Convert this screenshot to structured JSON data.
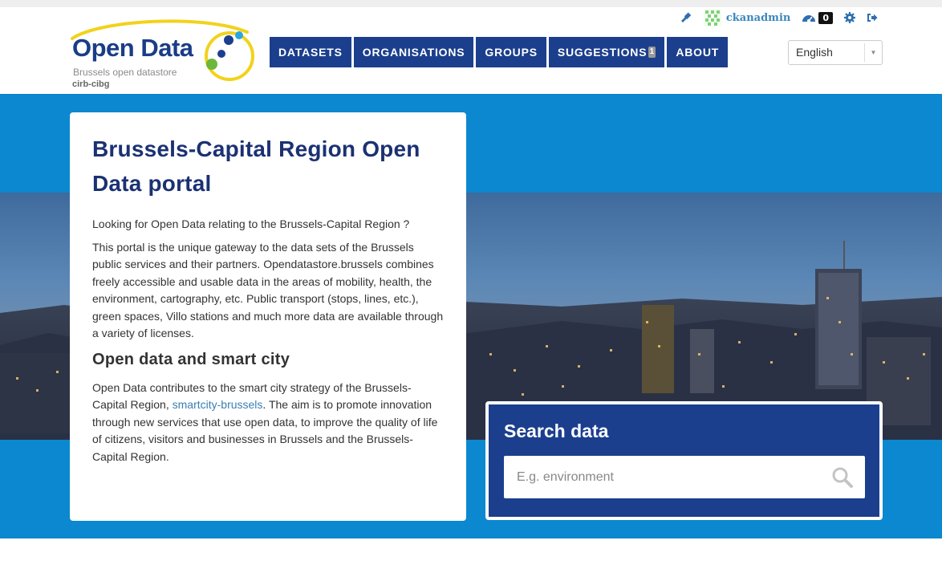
{
  "account": {
    "username": "ckanadmin",
    "dashboard_count": "0"
  },
  "logo": {
    "title": "Open Data",
    "subtitle": "Brussels open datastore",
    "org": "cirb-cibg"
  },
  "nav": {
    "items": [
      {
        "label": "DATASETS"
      },
      {
        "label": "ORGANISATIONS"
      },
      {
        "label": "GROUPS"
      },
      {
        "label": "SUGGESTIONS",
        "badge": "1"
      },
      {
        "label": "ABOUT"
      }
    ]
  },
  "language": {
    "selected": "English"
  },
  "intro": {
    "title": "Brussels-Capital Region Open Data portal",
    "p1": "Looking for Open Data relating to the Brussels-Capital Region ?",
    "p2": "This portal is the unique gateway to the data sets of the Brussels public services and their partners. Opendatastore.brussels combines freely accessible and usable data in the areas of mobility, health, the environment, cartography, etc. Public transport (stops, lines, etc.), green spaces, Villo stations and much more data are available through a variety of licenses.",
    "heading2": "Open data and smart city",
    "p3_before": "Open Data contributes to the smart city strategy of the Brussels-Capital Region, ",
    "p3_link": "smartcity-brussels",
    "p3_after": ". The aim is to promote innovation through new services that use open data, to improve the quality of life of citizens, visitors and businesses in Brussels and the Brussels-Capital Region."
  },
  "search": {
    "title": "Search data",
    "placeholder": "E.g. environment"
  },
  "colors": {
    "brand_navy": "#1b3f8d",
    "hero_blue": "#0b88cf",
    "link": "#3a87bd"
  }
}
